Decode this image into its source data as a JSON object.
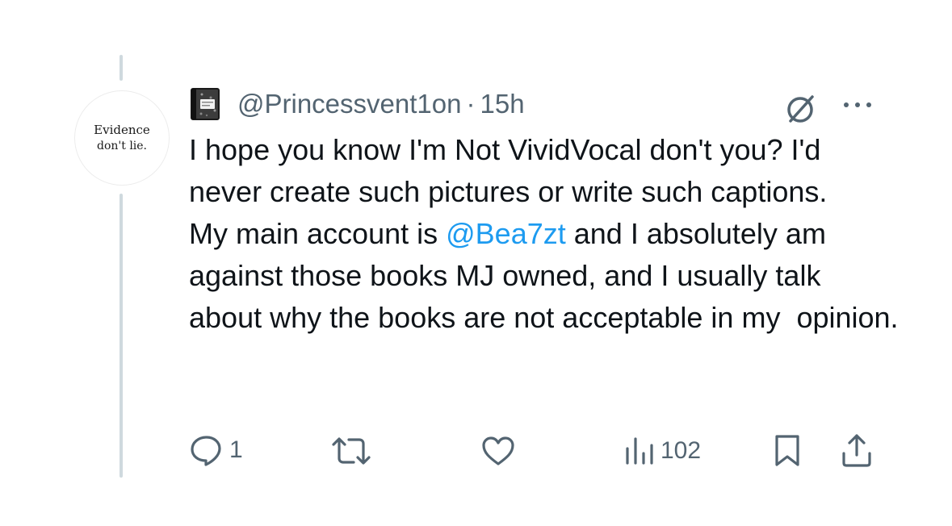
{
  "avatar": {
    "line1": "Evidence",
    "line2": "don't lie."
  },
  "header": {
    "handle": "@Princessvent1on",
    "separator": "·",
    "time": "15h"
  },
  "post": {
    "paragraph1": "I hope you know I'm Not VividVocal don't you? I'd never create such pictures or write such captions.",
    "paragraph2_before": "My main account is ",
    "mention": "@Bea7zt",
    "paragraph2_after": " and I absolutely am against those books MJ owned, and I usually talk about why the books are not acceptable in my  opinion."
  },
  "actions": {
    "replies": "1",
    "reposts": "",
    "likes": "",
    "views": "102"
  },
  "icons": {
    "badge": "notebook-icon",
    "grok": "grok-icon",
    "more": "more-icon",
    "reply": "reply-icon",
    "repost": "repost-icon",
    "like": "heart-icon",
    "views": "views-icon",
    "bookmark": "bookmark-icon",
    "share": "share-icon"
  },
  "colors": {
    "text": "#0f1419",
    "secondary": "#536471",
    "mention": "#1d9bf0",
    "thread_line": "#cfd9de"
  }
}
